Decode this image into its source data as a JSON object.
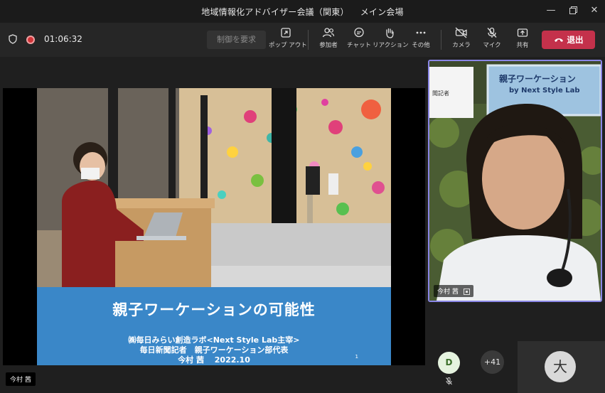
{
  "window": {
    "title": "地域情報化アドバイザー会議（関東）",
    "subtitle": "メイン会場"
  },
  "toolbar": {
    "timer": "01:06:32",
    "request_control": "制御を要求",
    "popout": "ポップ アウト",
    "participants": "参加者",
    "chat": "チャット",
    "reactions": "リアクション",
    "more": "その他",
    "camera": "カメラ",
    "mic": "マイク",
    "share": "共有",
    "leave": "退出"
  },
  "slide": {
    "title": "親子ワーケーションの可能性",
    "line1": "㈱毎日みらい創造ラボ<Next Style Lab主宰>",
    "line2": "毎日新聞記者　親子ワーケーション部代表",
    "line3": "今村 茜　 2022.10",
    "page_number": "1"
  },
  "presenter": {
    "name": "今村 茜",
    "sign_text": "親子ワーケーション",
    "sign_sub": "by Next Style Lab",
    "paper_text": "聞記者"
  },
  "participants": {
    "avatar_d": "D",
    "more_count": "+41",
    "avatar_big": "大"
  },
  "sharer": {
    "name": "今村 茜"
  },
  "colors": {
    "leave_red": "#c4314b",
    "slide_banner": "#3a87c8",
    "active_speaker_border": "#8a86e6"
  }
}
